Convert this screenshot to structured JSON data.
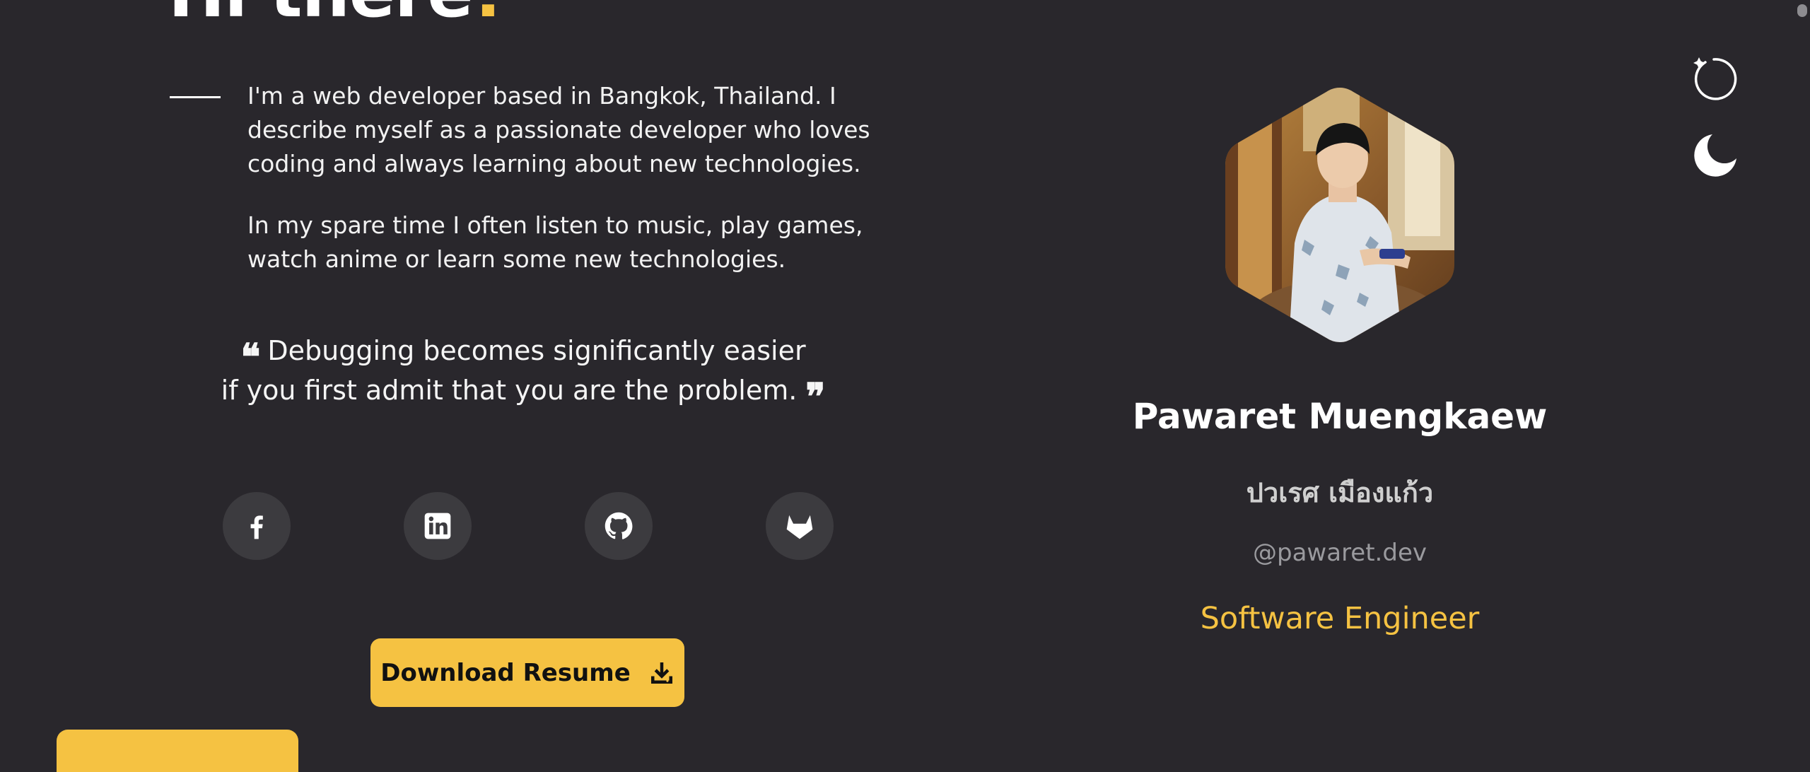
{
  "hero": {
    "title_main": "Hi there",
    "title_accent": "!"
  },
  "intro": {
    "paragraph1": "I'm a web developer based in Bangkok, Thailand. I describe myself as a passionate developer who loves coding and always learning about new technologies.",
    "paragraph2": "In my spare time I often listen to music, play games, watch anime or learn some new technologies."
  },
  "quote": {
    "open_mark": "❝",
    "line1": "Debugging becomes significantly easier",
    "line2": "if you first admit that you are the problem.",
    "close_mark": "❞"
  },
  "social": [
    {
      "name": "Facebook",
      "icon": "facebook-icon"
    },
    {
      "name": "LinkedIn",
      "icon": "linkedin-icon"
    },
    {
      "name": "GitHub",
      "icon": "github-icon"
    },
    {
      "name": "GitLab",
      "icon": "gitlab-icon"
    }
  ],
  "resume_button": {
    "label": "Download Resume",
    "icon": "download-icon"
  },
  "profile": {
    "name": "Pawaret Muengkaew",
    "name_thai": "ปวเรศ เมืองแก้ว",
    "handle": "@pawaret.dev",
    "role": "Software Engineer",
    "avatar": "hexagon-profile-photo"
  },
  "controls": {
    "theme_icon": "moon-icon",
    "refresh_icon": "sparkle-refresh-icon"
  },
  "colors": {
    "background": "#29272c",
    "accent": "#f5c242",
    "social_bg": "#3c3b3f",
    "text": "#ffffff",
    "muted": "#9a9a9e"
  }
}
